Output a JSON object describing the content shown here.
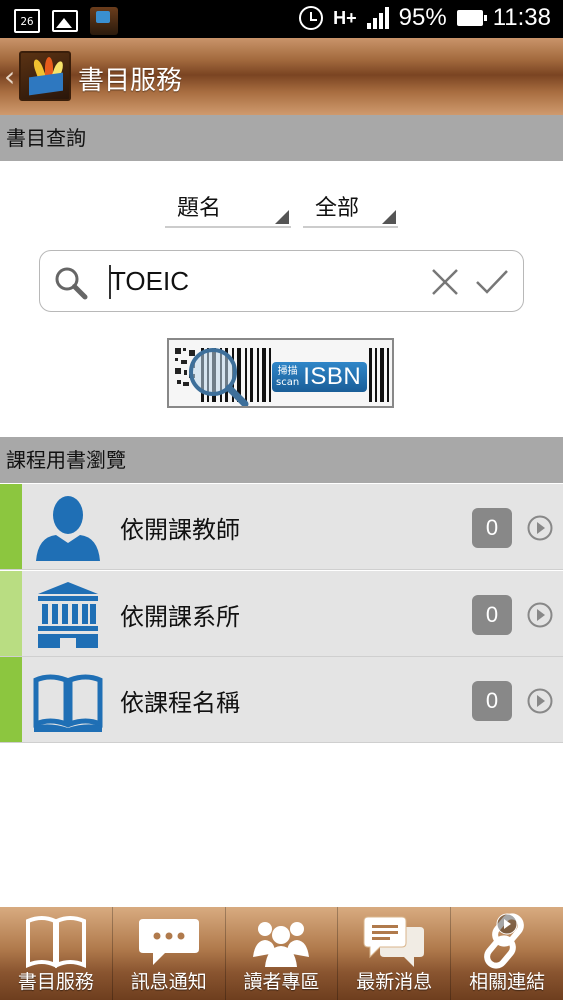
{
  "status_bar": {
    "date_icon_text": "26",
    "network": "H+",
    "battery": "95%",
    "time": "11:38"
  },
  "header": {
    "title": "書目服務"
  },
  "search_section": {
    "title": "書目查詢",
    "field_dropdown": "題名",
    "scope_dropdown": "全部",
    "query_value": "TOEIC",
    "isbn_button": {
      "zh": "掃描",
      "en": "scan",
      "label": "ISBN"
    }
  },
  "browse_section": {
    "title": "課程用書瀏覽",
    "items": [
      {
        "label": "依開課教師",
        "count": "0",
        "icon": "teacher-icon",
        "accent": "#8cc63f"
      },
      {
        "label": "依開課系所",
        "count": "0",
        "icon": "building-icon",
        "accent": "#b9dd82"
      },
      {
        "label": "依課程名稱",
        "count": "0",
        "icon": "open-book-icon",
        "accent": "#8cc63f"
      }
    ]
  },
  "bottom_nav": {
    "items": [
      {
        "label": "書目服務",
        "icon": "book-icon"
      },
      {
        "label": "訊息通知",
        "icon": "chat-bubble-icon"
      },
      {
        "label": "讀者專區",
        "icon": "users-icon"
      },
      {
        "label": "最新消息",
        "icon": "news-icon"
      },
      {
        "label": "相關連結",
        "icon": "link-icon"
      }
    ]
  },
  "colors": {
    "section_header": "#a8a8a8",
    "list_bg": "#e4e4e4",
    "accent_green": "#8cc63f",
    "icon_blue": "#1f6fb5"
  }
}
